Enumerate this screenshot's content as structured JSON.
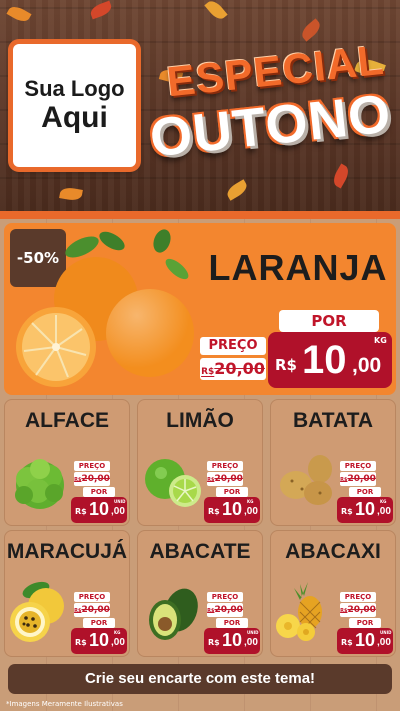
{
  "header": {
    "logo_line1": "Sua Logo",
    "logo_line2": "Aqui",
    "title_line1": "ESPECIAL",
    "title_line2": "OUTONO"
  },
  "hero": {
    "discount": "-50%",
    "name": "LARANJA",
    "preco_label": "PREÇO",
    "old_currency": "R$",
    "old_price": "20,00",
    "por_label": "POR",
    "currency": "R$",
    "price_int": "10",
    "price_dec": ",00",
    "unit": "KG"
  },
  "products": [
    {
      "name": "ALFACE",
      "preco_label": "PREÇO",
      "old_currency": "R$",
      "old_price": "20,00",
      "por_label": "POR",
      "currency": "R$",
      "price_int": "10",
      "price_dec": ",00",
      "unit": "UNID"
    },
    {
      "name": "LIMÃO",
      "preco_label": "PREÇO",
      "old_currency": "R$",
      "old_price": "20,00",
      "por_label": "POR",
      "currency": "R$",
      "price_int": "10",
      "price_dec": ",00",
      "unit": "KG"
    },
    {
      "name": "BATATA",
      "preco_label": "PREÇO",
      "old_currency": "R$",
      "old_price": "20,00",
      "por_label": "POR",
      "currency": "R$",
      "price_int": "10",
      "price_dec": ",00",
      "unit": "KG"
    },
    {
      "name": "MARACUJÁ",
      "preco_label": "PREÇO",
      "old_currency": "R$",
      "old_price": "20,00",
      "por_label": "POR",
      "currency": "R$",
      "price_int": "10",
      "price_dec": ",00",
      "unit": "KG"
    },
    {
      "name": "ABACATE",
      "preco_label": "PREÇO",
      "old_currency": "R$",
      "old_price": "20,00",
      "por_label": "POR",
      "currency": "R$",
      "price_int": "10",
      "price_dec": ",00",
      "unit": "UNID"
    },
    {
      "name": "ABACAXI",
      "preco_label": "PREÇO",
      "old_currency": "R$",
      "old_price": "20,00",
      "por_label": "POR",
      "currency": "R$",
      "price_int": "10",
      "price_dec": ",00",
      "unit": "UNID"
    }
  ],
  "cta": "Crie seu encarte com este tema!",
  "footnote": "*Imagens Meramente Ilustrativas",
  "colors": {
    "accent_orange": "#f3862f",
    "price_red": "#b0112a",
    "wood_dark": "#5a3a2b",
    "card_tan": "#cf9b73"
  },
  "icons": [
    "orange-fruit-icon",
    "lettuce-icon",
    "lime-icon",
    "potato-icon",
    "passion-fruit-icon",
    "avocado-icon",
    "pineapple-icon",
    "autumn-leaf-icon"
  ]
}
